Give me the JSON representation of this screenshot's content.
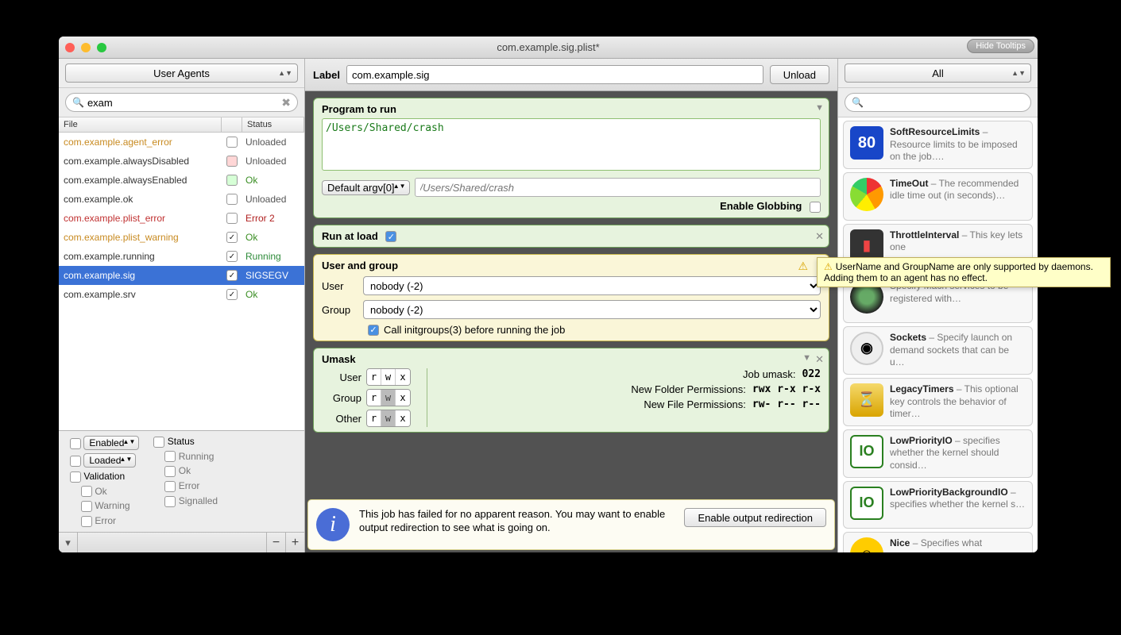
{
  "window": {
    "title": "com.example.sig.plist*",
    "hide_tooltips": "Hide Tooltips"
  },
  "left": {
    "category": "User Agents",
    "search": "exam",
    "headers": {
      "file": "File",
      "status": "Status"
    },
    "rows": [
      {
        "name": "com.example.agent_error",
        "color": "#c88a20",
        "checked": false,
        "chkstyle": "",
        "status": "Unloaded",
        "stclass": "st-un"
      },
      {
        "name": "com.example.alwaysDisabled",
        "color": "#333",
        "checked": false,
        "chkstyle": "red",
        "status": "Unloaded",
        "stclass": "st-un"
      },
      {
        "name": "com.example.alwaysEnabled",
        "color": "#333",
        "checked": false,
        "chkstyle": "green",
        "status": "Ok",
        "stclass": "st-ok"
      },
      {
        "name": "com.example.ok",
        "color": "#333",
        "checked": false,
        "chkstyle": "",
        "status": "Unloaded",
        "stclass": "st-un"
      },
      {
        "name": "com.example.plist_error",
        "color": "#c03030",
        "checked": false,
        "chkstyle": "",
        "status": "Error 2",
        "stclass": "st-err"
      },
      {
        "name": "com.example.plist_warning",
        "color": "#c88a20",
        "checked": true,
        "chkstyle": "",
        "status": "Ok",
        "stclass": "st-ok"
      },
      {
        "name": "com.example.running",
        "color": "#333",
        "checked": true,
        "chkstyle": "",
        "status": "Running",
        "stclass": "st-run"
      },
      {
        "name": "com.example.sig",
        "color": "",
        "checked": true,
        "chkstyle": "",
        "status": "SIGSEGV",
        "stclass": "",
        "selected": true
      },
      {
        "name": "com.example.srv",
        "color": "#333",
        "checked": true,
        "chkstyle": "",
        "status": "Ok",
        "stclass": "st-ok"
      }
    ],
    "filters": {
      "enabled": "Enabled",
      "loaded": "Loaded",
      "validation": "Validation",
      "ok": "Ok",
      "warning": "Warning",
      "error": "Error",
      "status": "Status",
      "running": "Running",
      "s_ok": "Ok",
      "s_error": "Error",
      "signalled": "Signalled"
    }
  },
  "mid": {
    "label_label": "Label",
    "label_value": "com.example.sig",
    "unload": "Unload",
    "program": {
      "title": "Program to run",
      "path": "/Users/Shared/crash",
      "argv_label": "Default argv[0]",
      "argv_placeholder": "/Users/Shared/crash",
      "glob": "Enable Globbing"
    },
    "runatload": "Run at load",
    "usergroup": {
      "title": "User and group",
      "user_label": "User",
      "user_value": "nobody (-2)",
      "group_label": "Group",
      "group_value": "nobody (-2)",
      "initgroups": "Call initgroups(3) before running the job"
    },
    "umask": {
      "title": "Umask",
      "user": "User",
      "group": "Group",
      "other": "Other",
      "job": "Job umask:",
      "job_v": "022",
      "nfolder": "New Folder Permissions:",
      "nfolder_v": "rwx r-x r-x",
      "nfile": "New File Permissions:",
      "nfile_v": "rw- r-- r--"
    },
    "info": {
      "text": "This job has failed for no apparent reason. You may want to enable output redirection to see what is going on.",
      "btn": "Enable output redirection"
    }
  },
  "right": {
    "category": "All",
    "keys": [
      {
        "ico": "ki-80",
        "glyph": "80",
        "title": "SoftResourceLimits",
        "desc": " – Resource limits to be imposed on the job…."
      },
      {
        "ico": "ki-time",
        "glyph": "",
        "title": "TimeOut",
        "desc": " – The recommended idle time out (in seconds)…"
      },
      {
        "ico": "ki-throttle",
        "glyph": "▮",
        "title": "ThrottleInterval",
        "desc": " – This key lets one"
      },
      {
        "ico": "ki-mach",
        "glyph": "",
        "title": "",
        "desc": "Specify Mach services to be registered with…"
      },
      {
        "ico": "ki-socket",
        "glyph": "◉",
        "title": "Sockets",
        "desc": " – Specify launch on demand sockets that can be u…"
      },
      {
        "ico": "ki-timer",
        "glyph": "⏳",
        "title": "LegacyTimers",
        "desc": " – This optional key controls the behavior of timer…"
      },
      {
        "ico": "ki-io",
        "glyph": "IO",
        "title": "LowPriorityIO",
        "desc": " – specifies whether the kernel should consid…"
      },
      {
        "ico": "ki-io",
        "glyph": "IO",
        "title": "LowPriorityBackgroundIO",
        "desc": " – specifies whether the kernel s…"
      },
      {
        "ico": "ki-nice",
        "glyph": "☺",
        "title": "Nice",
        "desc": " – Specifies what"
      }
    ]
  },
  "tooltip": "UserName and GroupName are only supported by daemons. Adding them to an agent has no effect."
}
